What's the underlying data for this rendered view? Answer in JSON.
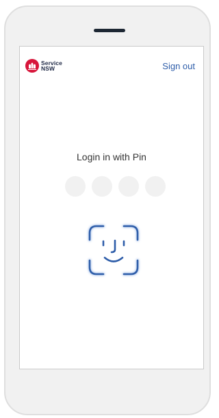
{
  "brand": {
    "name_line1": "Service",
    "name_line2": "NSW",
    "logo_icon": "service-nsw-waratah-logo",
    "color": "#d7153a"
  },
  "header": {
    "sign_out_label": "Sign out",
    "link_color": "#2e5da9"
  },
  "login": {
    "title": "Login in with Pin",
    "pin_length": 4,
    "biometric_icon": "face-id-icon",
    "accent_color": "#2e5da9"
  }
}
